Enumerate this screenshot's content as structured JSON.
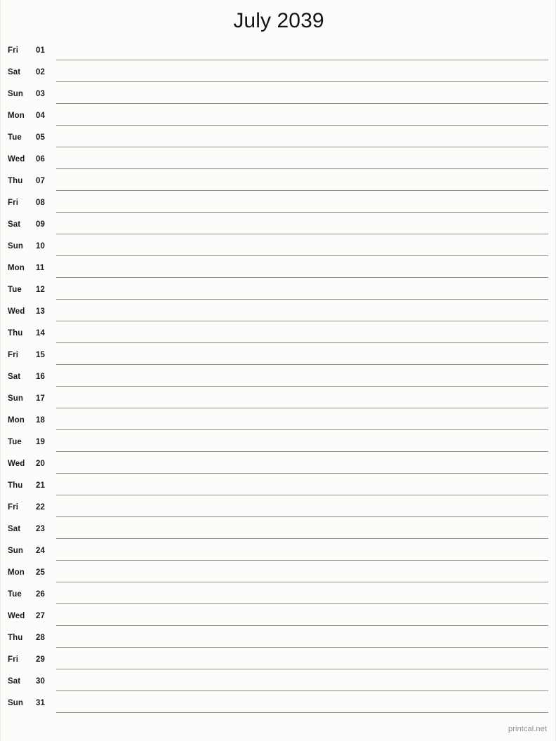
{
  "document": {
    "title": "July 2039",
    "month": "July",
    "year": "2039",
    "type": "single-column-notes-calendar"
  },
  "colors": {
    "background": "#fcfdfa",
    "text": "#1a1a1a",
    "rule": "#8a8f88",
    "footer": "#8d8d8d"
  },
  "columns": {
    "weekday_header": "",
    "date_header": "",
    "notes_header": ""
  },
  "days": [
    {
      "weekday": "Fri",
      "date": "01",
      "notes": ""
    },
    {
      "weekday": "Sat",
      "date": "02",
      "notes": ""
    },
    {
      "weekday": "Sun",
      "date": "03",
      "notes": ""
    },
    {
      "weekday": "Mon",
      "date": "04",
      "notes": ""
    },
    {
      "weekday": "Tue",
      "date": "05",
      "notes": ""
    },
    {
      "weekday": "Wed",
      "date": "06",
      "notes": ""
    },
    {
      "weekday": "Thu",
      "date": "07",
      "notes": ""
    },
    {
      "weekday": "Fri",
      "date": "08",
      "notes": ""
    },
    {
      "weekday": "Sat",
      "date": "09",
      "notes": ""
    },
    {
      "weekday": "Sun",
      "date": "10",
      "notes": ""
    },
    {
      "weekday": "Mon",
      "date": "11",
      "notes": ""
    },
    {
      "weekday": "Tue",
      "date": "12",
      "notes": ""
    },
    {
      "weekday": "Wed",
      "date": "13",
      "notes": ""
    },
    {
      "weekday": "Thu",
      "date": "14",
      "notes": ""
    },
    {
      "weekday": "Fri",
      "date": "15",
      "notes": ""
    },
    {
      "weekday": "Sat",
      "date": "16",
      "notes": ""
    },
    {
      "weekday": "Sun",
      "date": "17",
      "notes": ""
    },
    {
      "weekday": "Mon",
      "date": "18",
      "notes": ""
    },
    {
      "weekday": "Tue",
      "date": "19",
      "notes": ""
    },
    {
      "weekday": "Wed",
      "date": "20",
      "notes": ""
    },
    {
      "weekday": "Thu",
      "date": "21",
      "notes": ""
    },
    {
      "weekday": "Fri",
      "date": "22",
      "notes": ""
    },
    {
      "weekday": "Sat",
      "date": "23",
      "notes": ""
    },
    {
      "weekday": "Sun",
      "date": "24",
      "notes": ""
    },
    {
      "weekday": "Mon",
      "date": "25",
      "notes": ""
    },
    {
      "weekday": "Tue",
      "date": "26",
      "notes": ""
    },
    {
      "weekday": "Wed",
      "date": "27",
      "notes": ""
    },
    {
      "weekday": "Thu",
      "date": "28",
      "notes": ""
    },
    {
      "weekday": "Fri",
      "date": "29",
      "notes": ""
    },
    {
      "weekday": "Sat",
      "date": "30",
      "notes": ""
    },
    {
      "weekday": "Sun",
      "date": "31",
      "notes": ""
    }
  ],
  "footer": {
    "credit": "printcal.net"
  }
}
